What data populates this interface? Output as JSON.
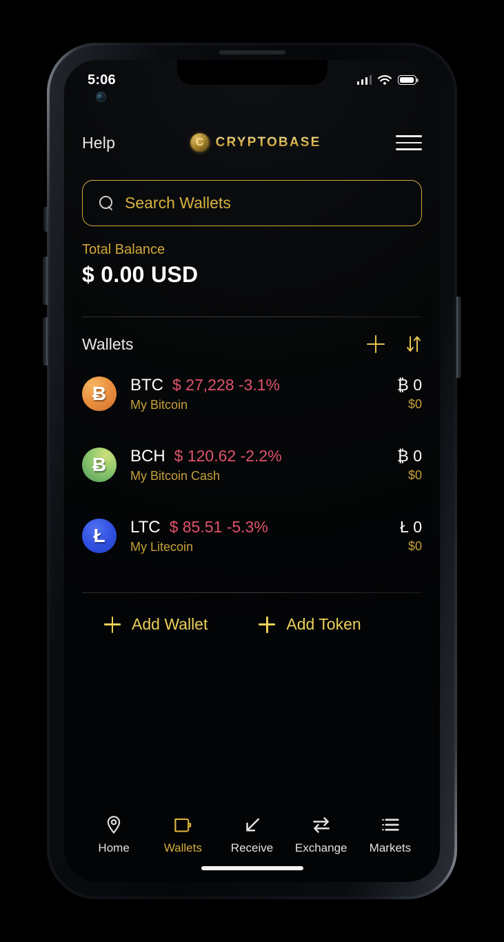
{
  "status_bar": {
    "time": "5:06",
    "signal_icon": "signal-bars-icon",
    "wifi_icon": "wifi-icon",
    "battery_icon": "battery-full-icon"
  },
  "header": {
    "help_label": "Help",
    "brand_mark": "C",
    "brand_name": "CRYPTOBASE",
    "menu_icon": "hamburger-menu-icon"
  },
  "search": {
    "icon": "search-icon",
    "placeholder": "Search Wallets",
    "value": "",
    "border_color": "#d5aa3c"
  },
  "balance": {
    "label": "Total Balance",
    "amount": "$ 0.00 USD"
  },
  "wallets_section": {
    "title": "Wallets",
    "add_icon": "plus-icon",
    "sort_icon": "sort-arrows-icon",
    "rows": [
      {
        "symbol": "BTC",
        "price": "$ 27,228 -3.1%",
        "name": "My Bitcoin",
        "amount": "₿ 0",
        "fiat": "$0",
        "icon": "bitcoin-icon",
        "glyph": "Ƀ",
        "color": "#eb9040",
        "change_color": "#e0536b"
      },
      {
        "symbol": "BCH",
        "price": "$ 120.62 -2.2%",
        "name": "My Bitcoin Cash",
        "amount": "₿ 0",
        "fiat": "$0",
        "icon": "bitcoin-cash-icon",
        "glyph": "Ƀ",
        "color": "#8ec86e",
        "change_color": "#e0536b"
      },
      {
        "symbol": "LTC",
        "price": "$ 85.51 -5.3%",
        "name": "My Litecoin",
        "amount": "Ł 0",
        "fiat": "$0",
        "icon": "litecoin-icon",
        "glyph": "Ł",
        "color": "#2f4fe0",
        "change_color": "#e0536b"
      }
    ]
  },
  "actions": {
    "add_wallet_label": "Add Wallet",
    "add_token_label": "Add Token",
    "add_wallet_icon": "plus-icon",
    "add_token_icon": "plus-icon"
  },
  "tabbar": {
    "active": "Wallets",
    "items": [
      {
        "label": "Home",
        "icon": "location-pin-icon",
        "active": false
      },
      {
        "label": "Wallets",
        "icon": "wallet-icon",
        "active": true
      },
      {
        "label": "Receive",
        "icon": "arrow-down-left-icon",
        "active": false
      },
      {
        "label": "Exchange",
        "icon": "swap-arrows-icon",
        "active": false
      },
      {
        "label": "Markets",
        "icon": "list-icon",
        "active": false
      }
    ]
  },
  "theme": {
    "gold": "#d5aa3c",
    "gold_bright": "#ecd05a",
    "red": "#e0536b",
    "screen_bg": "#050607"
  }
}
